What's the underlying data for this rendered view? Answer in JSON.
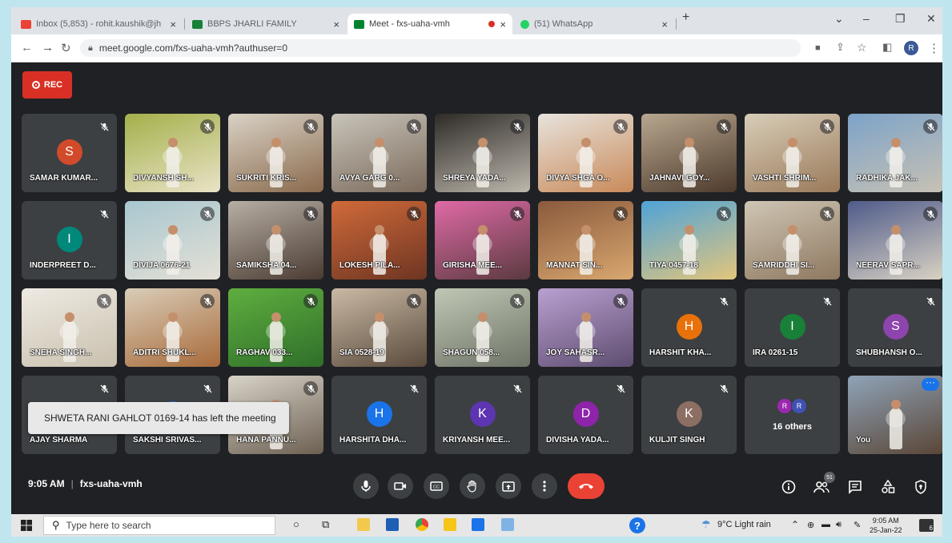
{
  "browser": {
    "tabs": [
      {
        "title": "Inbox (5,853) - rohit.kaushik@jh",
        "favicon_color": "#ea4335",
        "active": false
      },
      {
        "title": "BBPS JHARLI FAMILY",
        "favicon_color": "#188038",
        "active": false
      },
      {
        "title": "Meet - fxs-uaha-vmh",
        "favicon_color": "#00832d",
        "active": true,
        "recording": true
      },
      {
        "title": "(51) WhatsApp",
        "favicon_color": "#25d366",
        "active": false
      }
    ],
    "new_tab": "+",
    "close_glyph": "×",
    "url": "meet.google.com/fxs-uaha-vmh?authuser=0",
    "profile_initial": "R",
    "window_controls": {
      "minimize": "–",
      "maximize": "❐",
      "close": "✕",
      "tab_search": "⌄"
    }
  },
  "meet": {
    "rec_label": "REC",
    "time": "9:05 AM",
    "meeting_code": "fxs-uaha-vmh",
    "participant_count": "51",
    "toast": "SHWETA RANI GAHLOT 0169-14 has left the meeting",
    "participants": [
      {
        "name": "SAMAR KUMAR...",
        "kind": "avatar",
        "initial": "S",
        "color": "#d14b2a"
      },
      {
        "name": "DIVYANSH SH...",
        "kind": "video",
        "c1": "#a4b04a",
        "c2": "#e9e3c7"
      },
      {
        "name": "SUKRITI KRIS...",
        "kind": "video",
        "c1": "#d9d2c5",
        "c2": "#8a6a4d"
      },
      {
        "name": "AVYA GARG 0...",
        "kind": "video",
        "c1": "#c8c4b9",
        "c2": "#7b6b5c"
      },
      {
        "name": "SHREYA YADA...",
        "kind": "video",
        "c1": "#2e2b28",
        "c2": "#bdb7ac"
      },
      {
        "name": "DIVYA SHGA O...",
        "kind": "video",
        "c1": "#e7e3dc",
        "c2": "#c98a5a"
      },
      {
        "name": "JAHNAVI GOY...",
        "kind": "video",
        "c1": "#b8a78f",
        "c2": "#4d3a2c"
      },
      {
        "name": "VASHTI SHRIM...",
        "kind": "video",
        "c1": "#d8cdb8",
        "c2": "#9a7a5a"
      },
      {
        "name": "RADHIKA JAK...",
        "kind": "video",
        "c1": "#7da3c8",
        "c2": "#c7c1b4"
      },
      {
        "name": "INDERPREET D...",
        "kind": "avatar",
        "initial": "I",
        "color": "#00897b"
      },
      {
        "name": "DIVIJA 0676-21",
        "kind": "video",
        "c1": "#a8c7cf",
        "c2": "#e4e0d6"
      },
      {
        "name": "SAMIKSHA 04...",
        "kind": "video",
        "c1": "#b7afa4",
        "c2": "#4a3b32"
      },
      {
        "name": "LOKESH PILA...",
        "kind": "video",
        "c1": "#d06a3a",
        "c2": "#6e3522"
      },
      {
        "name": "GIRISHA MEE...",
        "kind": "video",
        "c1": "#e06aa6",
        "c2": "#5b3a40"
      },
      {
        "name": "MANNAT SIN...",
        "kind": "video",
        "c1": "#8a5a3d",
        "c2": "#d9a76f"
      },
      {
        "name": "TIYA 0457-18",
        "kind": "video",
        "c1": "#4fa3d8",
        "c2": "#e2c57c"
      },
      {
        "name": "SAMRIDDHI SI...",
        "kind": "video",
        "c1": "#cfc6b4",
        "c2": "#8e7860"
      },
      {
        "name": "NEERAV SAPR...",
        "kind": "video",
        "c1": "#4f5b8a",
        "c2": "#d9d2c3"
      },
      {
        "name": "SNEHA SINGH...",
        "kind": "video",
        "c1": "#eeeae2",
        "c2": "#c9c0ae"
      },
      {
        "name": "ADITRI SHUKL...",
        "kind": "video",
        "c1": "#d9cdb8",
        "c2": "#a86a3a"
      },
      {
        "name": "RAGHAV 033...",
        "kind": "video",
        "c1": "#5fae3f",
        "c2": "#2f6f2a"
      },
      {
        "name": "SIA 0528-19",
        "kind": "video",
        "c1": "#c9b9a4",
        "c2": "#5a4a3c"
      },
      {
        "name": "SHAGUN 058...",
        "kind": "video",
        "c1": "#bfc7b5",
        "c2": "#6e7466"
      },
      {
        "name": "JOY SAHASR...",
        "kind": "video",
        "c1": "#b9a0d0",
        "c2": "#5e4d70"
      },
      {
        "name": "HARSHIT KHA...",
        "kind": "avatar",
        "initial": "H",
        "color": "#e8710a"
      },
      {
        "name": "IRA 0261-15",
        "kind": "avatar",
        "initial": "I",
        "color": "#188038"
      },
      {
        "name": "SHUBHANSH O...",
        "kind": "avatar",
        "initial": "S",
        "color": "#8e44ad"
      },
      {
        "name": "AJAY SHARMA",
        "kind": "avatar",
        "initial": "A",
        "color": "#3c4043"
      },
      {
        "name": "SAKSHI SRIVAS...",
        "kind": "avatar",
        "initial": "S",
        "color": "#1a73e8"
      },
      {
        "name": "HANA PANNU...",
        "kind": "video",
        "c1": "#d8d3c8",
        "c2": "#6c6052"
      },
      {
        "name": "HARSHITA DHA...",
        "kind": "avatar",
        "initial": "H",
        "color": "#1a73e8"
      },
      {
        "name": "KRIYANSH MEE...",
        "kind": "avatar",
        "initial": "K",
        "color": "#5e35b1"
      },
      {
        "name": "DIVISHA YADA...",
        "kind": "avatar",
        "initial": "D",
        "color": "#8e24aa"
      },
      {
        "name": "KULJIT SINGH",
        "kind": "avatar",
        "initial": "K",
        "color": "#8d6e63"
      },
      {
        "name": "16 others",
        "kind": "others",
        "mini": [
          {
            "initial": "R",
            "color": "#9c27b0"
          },
          {
            "initial": "R",
            "color": "#3f51b5"
          }
        ]
      },
      {
        "name": "You",
        "kind": "you",
        "c1": "#8fa3b8",
        "c2": "#5a4637"
      }
    ]
  },
  "taskbar": {
    "search_placeholder": "Type here to search",
    "weather": "9°C  Light rain",
    "time": "9:05 AM",
    "date": "25-Jan-22",
    "notif_count": "6"
  }
}
